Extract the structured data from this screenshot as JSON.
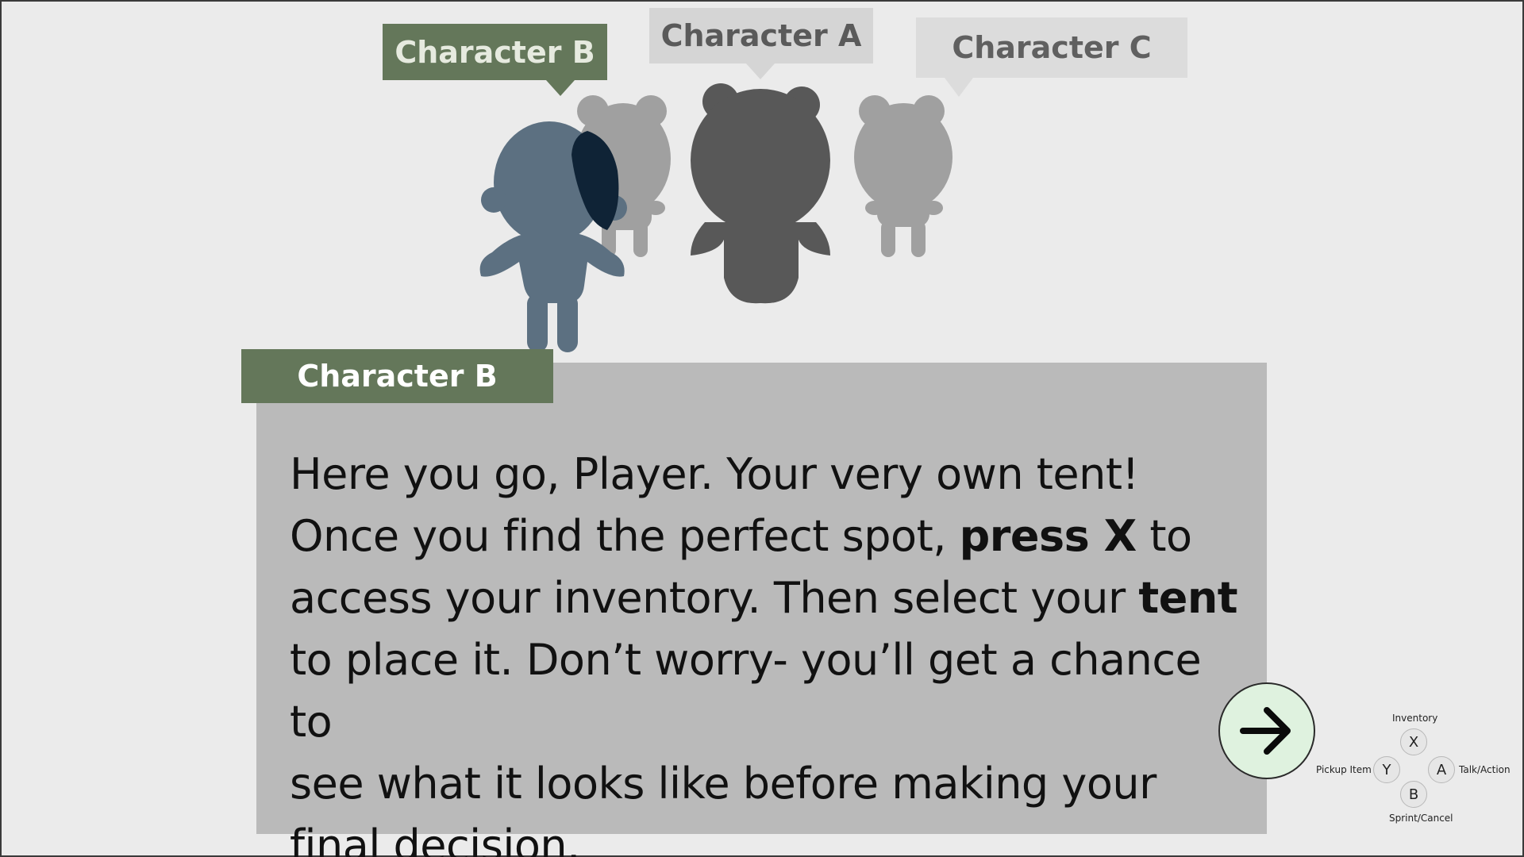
{
  "speech_tags": {
    "b": "Character B",
    "a": "Character A",
    "c": "Character C"
  },
  "dialog": {
    "speaker": "Character B",
    "lines": {
      "l1": "Here you go, Player. Your very own tent!",
      "l2_pre": "Once you find the perfect spot, ",
      "l2_bold": "press X",
      "l2_post": " to",
      "l3_pre": "access your inventory. Then select your ",
      "l3_bold": "tent",
      "l4": "to place it. Don’t worry- you’ll get a chance to",
      "l5": "see what it looks like before making your",
      "l6": "final decision."
    }
  },
  "next_button": {
    "icon": "arrow-right-icon"
  },
  "controls": {
    "x_label": "Inventory",
    "x": "X",
    "y_label": "Pickup Item",
    "y": "Y",
    "a_label": "Talk/Action",
    "a": "A",
    "b_label": "Sprint/Cancel",
    "b": "B"
  },
  "colors": {
    "accent_green": "#64775a",
    "player_silhouette": "#5c7081",
    "character_a": "#585858",
    "character_b": "#a0a0a0",
    "character_c": "#a0a0a0",
    "dialog_bg": "#bababa",
    "next_button_bg": "#dff2df"
  }
}
